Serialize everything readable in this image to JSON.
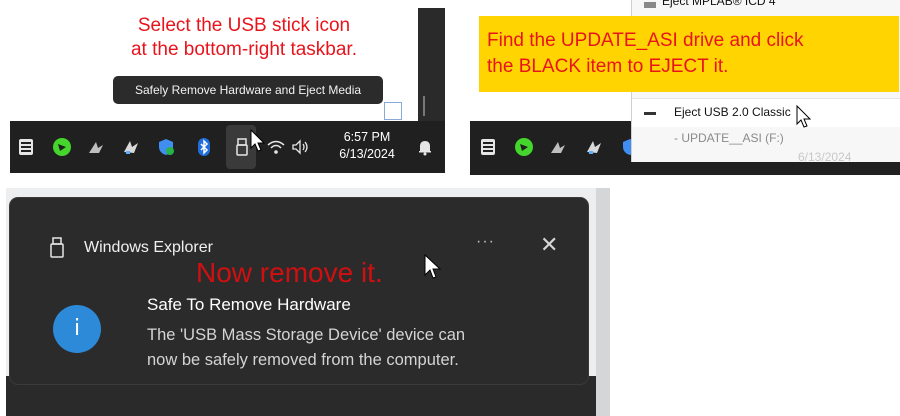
{
  "panel1": {
    "caption": [
      "Select the USB stick icon",
      "at the bottom-right taskbar."
    ],
    "tooltip": "Safely Remove Hardware and Eject Media",
    "clock": {
      "time": "6:57 PM",
      "date": "6/13/2024"
    },
    "taskbar_icons": [
      "epic-games-icon",
      "razer-icon",
      "steelseries-icon",
      "app-icon",
      "defender-icon",
      "bluetooth-icon",
      "usb-drive-icon",
      "wifi-icon",
      "volume-icon",
      "notification-bell-icon"
    ],
    "caption_color": "#e8141c"
  },
  "panel2": {
    "caption": [
      "Find the UPDATE_ASI drive and click",
      "the BLACK item to EJECT it."
    ],
    "caption_bg": "#ffd400",
    "menu": {
      "top_item": "Eject MPLAB® ICD 4",
      "items": [
        {
          "label": "Eject USB 2.0 Classic"
        },
        {
          "label": "- UPDATE__ASI (F:)"
        }
      ]
    },
    "clock": {
      "date": "6/13/2024"
    }
  },
  "panel3": {
    "app_name": "Windows Explorer",
    "annotation": "Now remove it.",
    "headline": "Safe To Remove Hardware",
    "body": [
      "The 'USB Mass Storage Device' device can",
      "now be safely removed from the computer."
    ],
    "more_label": "···",
    "close_label": "✕",
    "info_glyph": "i",
    "accent": "#2d8ad8"
  }
}
